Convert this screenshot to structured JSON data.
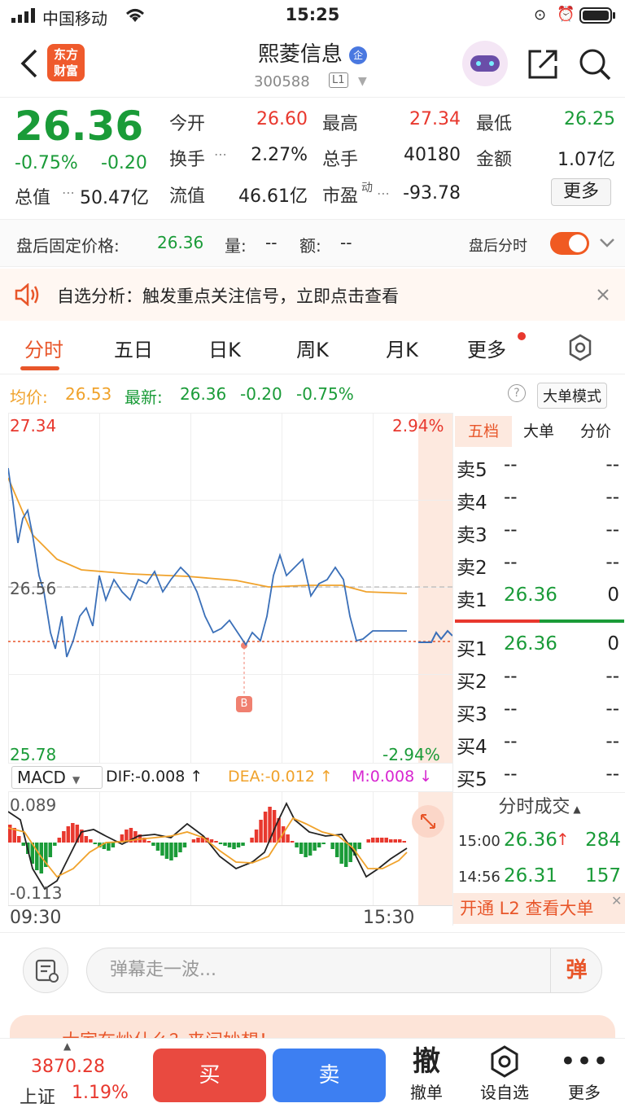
{
  "status_bar": {
    "carrier": "中国移动",
    "time": "15:25"
  },
  "header": {
    "logo_line1": "东方",
    "logo_line2": "财富",
    "stock_name": "熙菱信息",
    "stock_code": "300588",
    "level_badge": "L1"
  },
  "quote": {
    "price": "26.36",
    "change_pct": "-0.75%",
    "change": "-0.20",
    "open_label": "今开",
    "open": "26.60",
    "high_label": "最高",
    "high": "27.34",
    "low_label": "最低",
    "low": "26.25",
    "turnover_label": "换手",
    "turnover": "2.27%",
    "volume_label": "总手",
    "volume": "40180",
    "amount_label": "金额",
    "amount": "1.07亿",
    "mktcap_label": "总值",
    "mktcap": "50.47亿",
    "float_label": "流值",
    "float": "46.61亿",
    "pe_label": "市盈",
    "pe_sup": "动",
    "pe": "-93.78",
    "more_label": "更多"
  },
  "after_hours": {
    "label": "盘后固定价格:",
    "price": "26.36",
    "vol_label": "量:",
    "vol": "--",
    "amt_label": "额:",
    "amt": "--",
    "toggle_label": "盘后分时"
  },
  "notice": {
    "text": "自选分析：触发重点关注信号，立即点击查看"
  },
  "tabs": [
    {
      "label": "分时"
    },
    {
      "label": "五日"
    },
    {
      "label": "日K"
    },
    {
      "label": "周K"
    },
    {
      "label": "月K"
    },
    {
      "label": "更多"
    }
  ],
  "info_row": {
    "avg_label": "均价:",
    "avg": "26.53",
    "latest_label": "最新:",
    "latest": "26.36",
    "chg": "-0.20",
    "chg_pct": "-0.75%",
    "mode_btn": "大单模式"
  },
  "chart": {
    "price_top": "27.34",
    "price_mid": "26.56",
    "price_bottom": "25.78",
    "pct_top": "2.94%",
    "pct_bottom": "-2.94%",
    "marker": "B",
    "time_start": "09:30",
    "time_end": "15:30",
    "macd_label": "MACD",
    "dif": "DIF:-0.008 ↑",
    "dea": "DEA:-0.012 ↑",
    "m": "M:0.008 ↓",
    "macd_top": "0.089",
    "macd_bottom": "-0.113"
  },
  "order_book": {
    "tabs": [
      "五档",
      "大单",
      "分价"
    ],
    "asks": [
      {
        "label": "卖5",
        "price": "--",
        "vol": "--"
      },
      {
        "label": "卖4",
        "price": "--",
        "vol": "--"
      },
      {
        "label": "卖3",
        "price": "--",
        "vol": "--"
      },
      {
        "label": "卖2",
        "price": "--",
        "vol": "--"
      },
      {
        "label": "卖1",
        "price": "26.36",
        "vol": "0"
      }
    ],
    "bids": [
      {
        "label": "买1",
        "price": "26.36",
        "vol": "0"
      },
      {
        "label": "买2",
        "price": "--",
        "vol": "--"
      },
      {
        "label": "买3",
        "price": "--",
        "vol": "--"
      },
      {
        "label": "买4",
        "price": "--",
        "vol": "--"
      },
      {
        "label": "买5",
        "price": "--",
        "vol": "--"
      }
    ],
    "trades_title": "分时成交",
    "trades": [
      {
        "time": "15:00",
        "price": "26.36",
        "arrow": "↑",
        "vol": "284"
      },
      {
        "time": "14:56",
        "price": "26.31",
        "arrow": "",
        "vol": "157"
      }
    ],
    "l2_promo": "开通 L2 查看大单"
  },
  "danmu": {
    "placeholder": "弹幕走一波...",
    "send_label": "弹"
  },
  "banner": {
    "text": "大家在炒什么？来问妙想！"
  },
  "bottom_bar": {
    "index_value": "3870.28",
    "index_name": "上证",
    "index_pct": "1.19%",
    "buy": "买",
    "sell": "卖",
    "cancel_icon": "撤",
    "cancel": "撤单",
    "watch": "设自选",
    "more": "更多"
  },
  "colors": {
    "up": "#e8382e",
    "down": "#1a9b38",
    "accent": "#e8562a",
    "avg_line": "#f0a22b",
    "price_line": "#3a6fb8"
  }
}
